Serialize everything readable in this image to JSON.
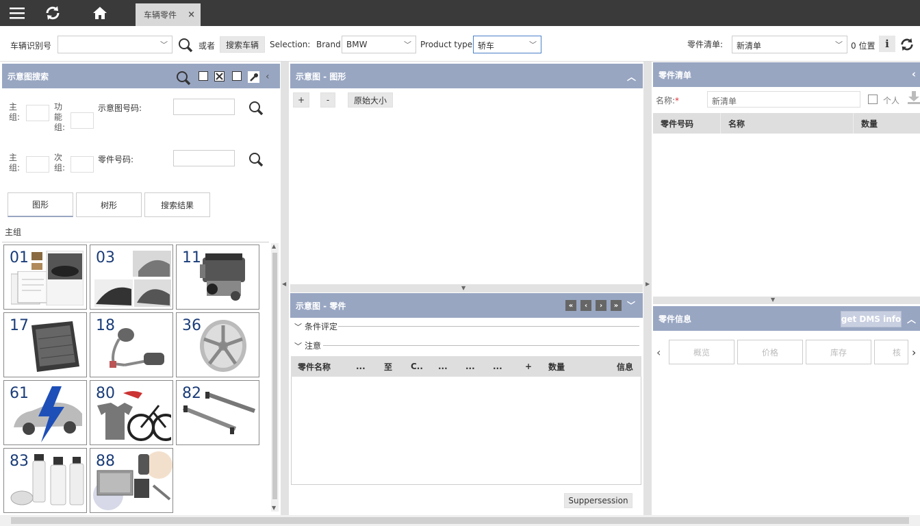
{
  "topbar": {
    "menu_icon": "menu-icon",
    "refresh_icon": "refresh-icon",
    "home_icon": "home-icon",
    "tab_label": "车辆零件",
    "tab_close": "×"
  },
  "toolbar": {
    "vin_label": "车辆识别号",
    "vin_value": "",
    "or_label": "或者",
    "search_vehicle": "搜索车辆",
    "selection_label": "Selection:",
    "brand_label": "Brand",
    "brand_value": "BMW",
    "product_type_label": "Product type",
    "product_type_value": "轿车",
    "parts_list_label": "零件清单:",
    "parts_list_value": "新清单",
    "position_label": "0 位置"
  },
  "diagram_search": {
    "title": "示意图搜索",
    "main_group_label": "主组:",
    "function_group_label": "功能组:",
    "diagram_no_label": "示意图号码:",
    "sub_group_label": "次组:",
    "part_no_label": "零件号码:",
    "view_tabs": [
      "图形",
      "树形",
      "搜索结果"
    ],
    "section_label": "主组",
    "groups": [
      {
        "num": "01"
      },
      {
        "num": "03"
      },
      {
        "num": "11"
      },
      {
        "num": "17"
      },
      {
        "num": "18"
      },
      {
        "num": "36"
      },
      {
        "num": "61"
      },
      {
        "num": "80"
      },
      {
        "num": "82"
      },
      {
        "num": "83"
      },
      {
        "num": "88"
      }
    ]
  },
  "diagram_graphic": {
    "title": "示意图 - 图形",
    "zoom_in": "+",
    "zoom_out": "-",
    "original_size": "原始大小"
  },
  "diagram_parts": {
    "title": "示意图 - 零件",
    "condition_label": "条件评定",
    "notes_label": "注意",
    "columns": [
      "零件名称",
      "...",
      "至",
      "C..",
      "...",
      "...",
      "...",
      "+",
      "数量",
      "信息"
    ],
    "suppersession": "Suppersession"
  },
  "parts_list": {
    "title": "零件清单",
    "name_label": "名称:",
    "name_required": "*",
    "name_placeholder": "新清单",
    "personal_label": "个人",
    "columns": [
      "零件号码",
      "名称",
      "数量"
    ]
  },
  "parts_info": {
    "title": "零件信息",
    "dms_button": "get DMS info",
    "tabs": [
      "概览",
      "价格",
      "库存",
      "核"
    ]
  }
}
